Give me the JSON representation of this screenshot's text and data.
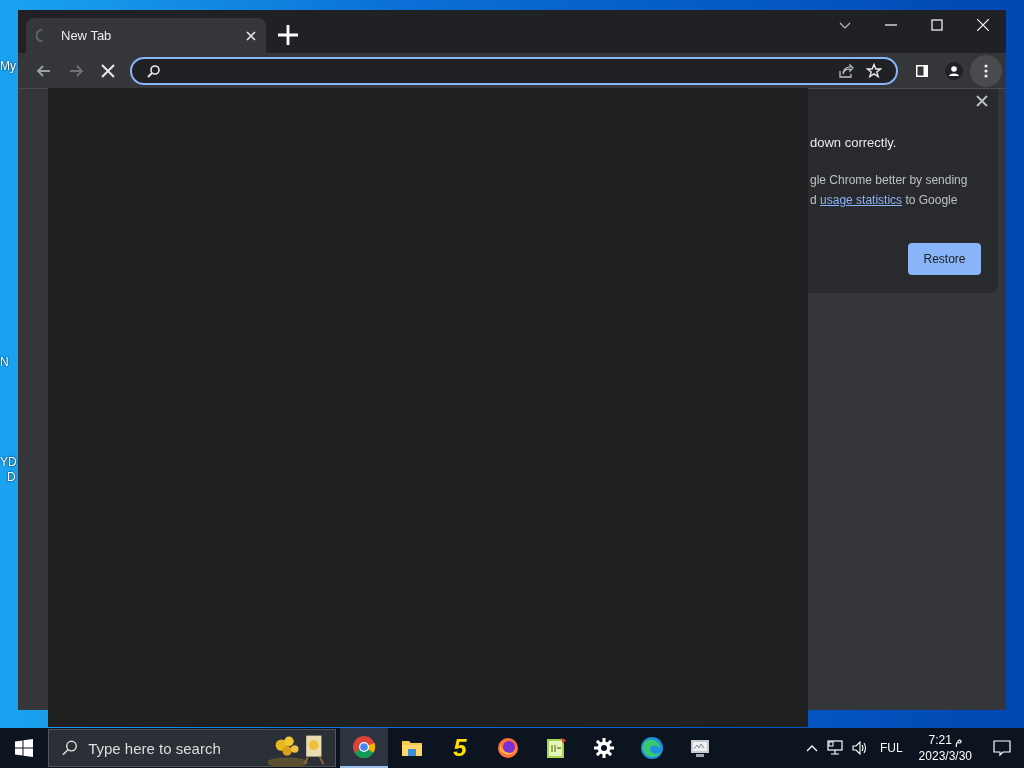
{
  "desktop": {
    "icon_labels": [
      {
        "text": "My"
      },
      {
        "text": "N"
      },
      {
        "text": "YD"
      },
      {
        "text": "D"
      }
    ]
  },
  "browser": {
    "tabs": [
      {
        "title": "New Tab",
        "selected": true,
        "loading": true
      }
    ],
    "toolbar": {
      "back_disabled": false,
      "forward_disabled": true,
      "loading": true,
      "menu_highlighted": true
    },
    "address_bar": {
      "focused": true
    },
    "restore_bubble": {
      "heading": "down correctly.",
      "line_1": "gle Chrome better by sending",
      "line_2_start": "d",
      "link": "usage statistics",
      "line_2_end": "to Google",
      "button": "Restore"
    }
  },
  "taskbar": {
    "search": {
      "placeholder": "Type here to search"
    },
    "apps": [
      {
        "kind": "chrome",
        "selected": true
      },
      {
        "kind": "folder",
        "selected": false
      },
      {
        "kind": "five",
        "label": "5",
        "selected": false
      },
      {
        "kind": "firefox",
        "selected": false
      },
      {
        "kind": "notepad",
        "selected": false
      },
      {
        "kind": "gear",
        "selected": false
      },
      {
        "kind": "edge",
        "selected": false
      },
      {
        "kind": "monitor",
        "selected": false
      }
    ],
    "tray": {
      "language": "FUL",
      "time": "7:21 م",
      "date": "2023/3/30"
    }
  }
}
